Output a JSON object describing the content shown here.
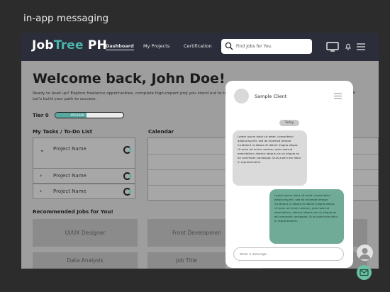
{
  "frame": {
    "title": "in-app messaging"
  },
  "header": {
    "logo_part1": "Job",
    "logo_part2": "Tree",
    "logo_part3": " PH",
    "nav": [
      "Dashboard",
      "My Projects",
      "Certification"
    ],
    "search_placeholder": "Find Jobs for You.",
    "icons": [
      "monitor-icon",
      "bell-icon",
      "menu-icon"
    ]
  },
  "welcome": {
    "title": "Welcome back, John Doe!",
    "subtitle": "Ready to level up? Explore freelance opportunities, complete high-impact proj you stand out to top clients. Let's build your path to success.",
    "subtitle_tail": "le"
  },
  "tier": {
    "label": "Tier 0",
    "progress_text": "455/1000",
    "progress": 0.455
  },
  "tasks": {
    "title": "My Tasks / To-Do List",
    "items": [
      {
        "name": "Project Name",
        "expanded": true
      },
      {
        "name": "Project Name",
        "expanded": false
      },
      {
        "name": "Project Name",
        "expanded": false
      }
    ]
  },
  "calendar": {
    "title": "Calendar"
  },
  "jobs": {
    "title": "Recommended Jobs for You!",
    "items": [
      "UI/UX Designer",
      "Front Developmen",
      "Data Analysis",
      "Job Title"
    ]
  },
  "chat": {
    "contact": "Sample Client",
    "date": "Today",
    "incoming": "Lorem ipsum dolor sit amet, consectetur adipiscing elit, sed do eiusmod tempor incididunt ut labore et dolore magna aliqua. Ut enim ad minim veniam, quis nostrud exercitation ullamco laboris nisi ut aliquip ex ea commodo consequat. Duis aute irure dolor in reprehenderit.",
    "outgoing": "Lorem ipsum dolor sit amet, consectetur adipiscing elit, sed do eiusmod tempor incididunt ut labore et dolore magna aliqua. Ut enim ad minim veniam, quis nostrud exercitation ullamco laboris nisi ut aliquip ex ea commodo consequat. Duis aute irure dolor in reprehenderit.",
    "input_placeholder": "Write a message..."
  },
  "colors": {
    "accent": "#4ab5ab",
    "topbar": "#2b2d3a",
    "outgoing_bubble": "#6fab97",
    "fab": "#6cc0a3"
  }
}
